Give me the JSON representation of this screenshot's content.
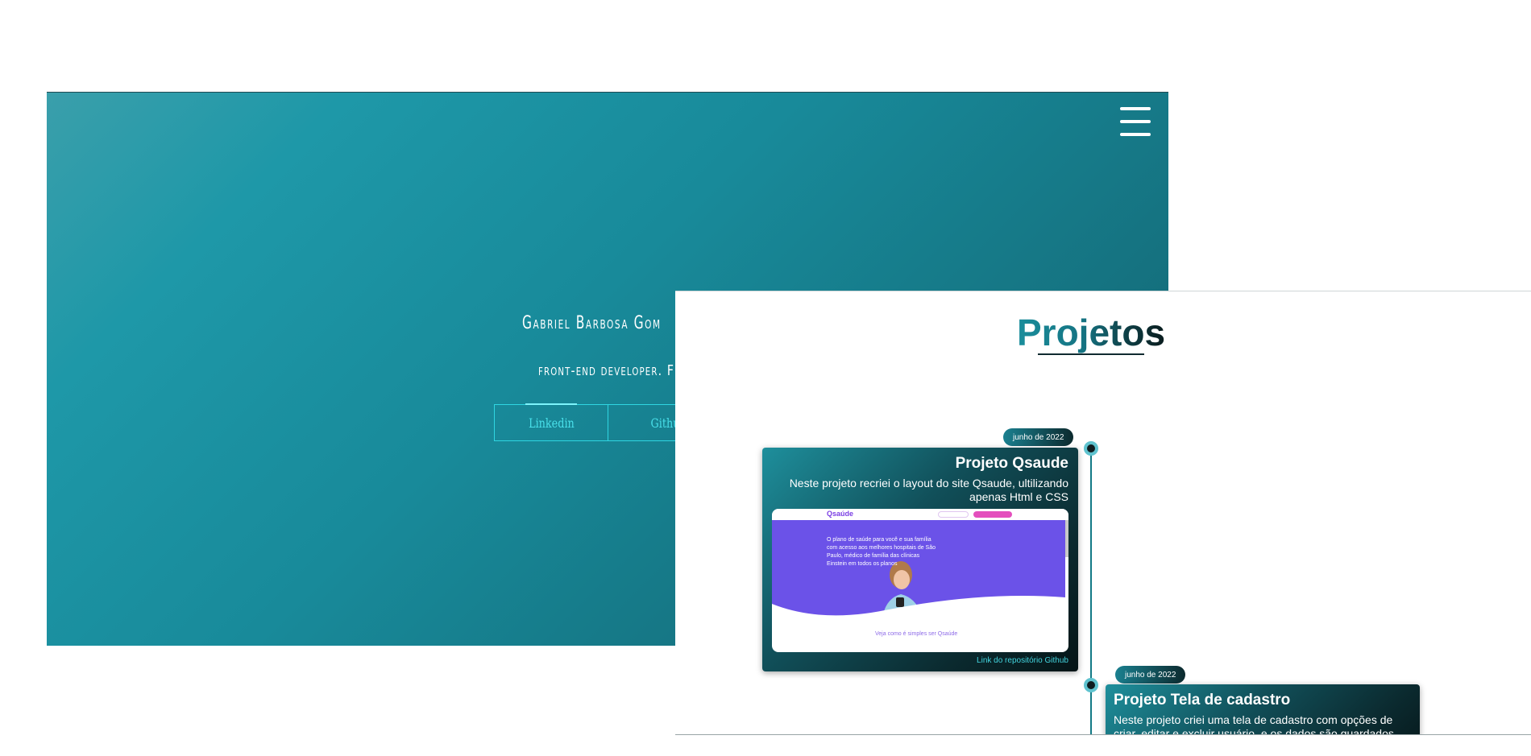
{
  "hero": {
    "name": "Gabriel Barbosa Gom",
    "role": "front-end developer. F",
    "links": [
      "Linkedin",
      "Githu"
    ],
    "menu_icon": "hamburger-menu-icon"
  },
  "projects": {
    "title": "Projetos",
    "items": [
      {
        "date": "junho de 2022",
        "title": "Projeto Qsaude",
        "description": "Neste projeto recriei o layout do site Qsaude, ultilizando apenas Html e CSS",
        "link": "Link do repositório Github",
        "preview": {
          "logo": "Qsaúde",
          "headline": "O plano de saúde para você e sua família com acesso aos melhores hospitais de São Paulo, médico de família das clínicas Einstein em todos os planos",
          "footer": "Veja como é simples ser Qsaúde"
        }
      },
      {
        "date": "junho de 2022",
        "title": "Projeto Tela de cadastro",
        "description": "Neste projeto criei uma tela de cadastro com opções de criar, editar e excluir usuário, e os dados são guardados"
      }
    ]
  },
  "colors": {
    "accent": "#1e98a8",
    "link": "#43d4de",
    "preview_purple": "#6b52e8"
  }
}
